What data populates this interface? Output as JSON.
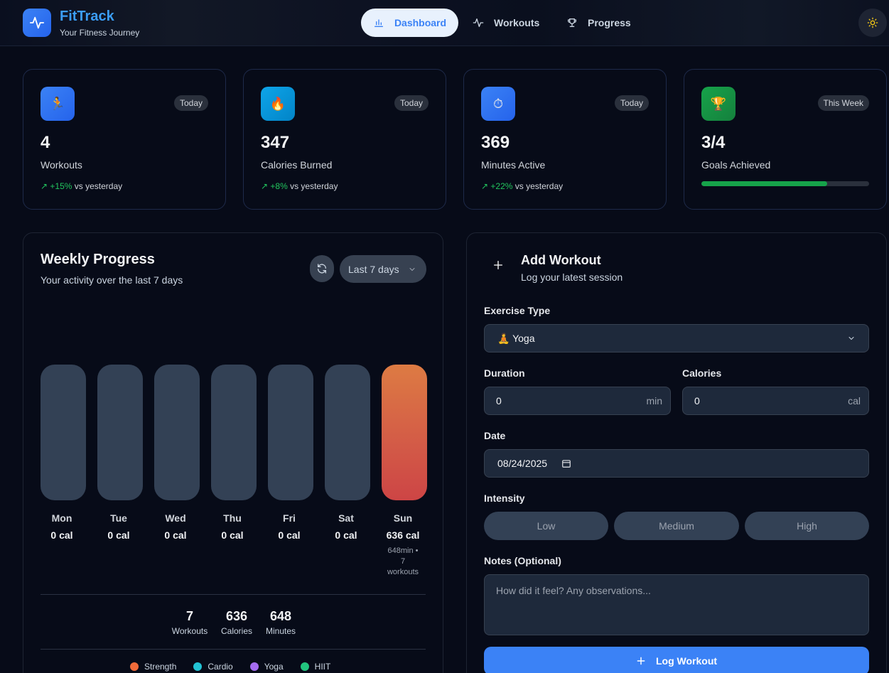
{
  "header": {
    "app_name": "FitTrack",
    "app_subtitle": "Your Fitness Journey",
    "nav": [
      {
        "label": "Dashboard",
        "icon": "bar-chart-icon",
        "active": true
      },
      {
        "label": "Workouts",
        "icon": "activity-icon",
        "active": false
      },
      {
        "label": "Progress",
        "icon": "trophy-icon",
        "active": false
      }
    ],
    "theme_toggle_icon": "sun-icon"
  },
  "stats": [
    {
      "value": "4",
      "label": "Workouts",
      "badge": "Today",
      "icon": "runner-icon",
      "change": "↗ +15%",
      "change_suffix": "vs yesterday",
      "color": "#3b82f6"
    },
    {
      "value": "347",
      "label": "Calories Burned",
      "badge": "Today",
      "icon": "flame-icon",
      "change": "↗ +8%",
      "change_suffix": "vs yesterday",
      "color": "#0ea5e9"
    },
    {
      "value": "369",
      "label": "Minutes Active",
      "badge": "Today",
      "icon": "stopwatch-icon",
      "change": "↗ +22%",
      "change_suffix": "vs yesterday",
      "color": "#3b82f6"
    },
    {
      "value": "3/4",
      "label": "Goals Achieved",
      "badge": "This Week",
      "icon": "trophy-icon",
      "goal_progress": 0.75,
      "color": "#16a34a"
    }
  ],
  "weekly": {
    "title": "Weekly Progress",
    "subtitle": "Your activity over the last 7 days",
    "range_select": "Last 7 days",
    "days": [
      {
        "day": "Mon",
        "cal": "0 cal"
      },
      {
        "day": "Tue",
        "cal": "0 cal"
      },
      {
        "day": "Wed",
        "cal": "0 cal"
      },
      {
        "day": "Thu",
        "cal": "0 cal"
      },
      {
        "day": "Fri",
        "cal": "0 cal"
      },
      {
        "day": "Sat",
        "cal": "0 cal"
      },
      {
        "day": "Sun",
        "cal": "636 cal",
        "extra": "648min • 7 workouts",
        "active": true
      }
    ],
    "summary": [
      {
        "value": "7",
        "label": "Workouts"
      },
      {
        "value": "636",
        "label": "Calories"
      },
      {
        "value": "648",
        "label": "Minutes"
      }
    ],
    "legend": [
      {
        "label": "Strength",
        "color": "#f26b3a"
      },
      {
        "label": "Cardio",
        "color": "#22c3d4"
      },
      {
        "label": "Yoga",
        "color": "#a56cf0"
      },
      {
        "label": "HIIT",
        "color": "#22c57e"
      }
    ]
  },
  "form": {
    "title": "Add Workout",
    "subtitle": "Log your latest session",
    "exercise_label": "Exercise Type",
    "exercise_value": "🧘 Yoga",
    "duration_label": "Duration",
    "duration_value": "0",
    "duration_unit": "min",
    "calories_label": "Calories",
    "calories_value": "0",
    "calories_unit": "cal",
    "date_label": "Date",
    "date_value": "08/24/2025",
    "intensity_label": "Intensity",
    "intensity_options": [
      "Low",
      "Medium",
      "High"
    ],
    "notes_label": "Notes (Optional)",
    "notes_placeholder": "How did it feel? Any observations...",
    "submit_label": "Log Workout"
  }
}
